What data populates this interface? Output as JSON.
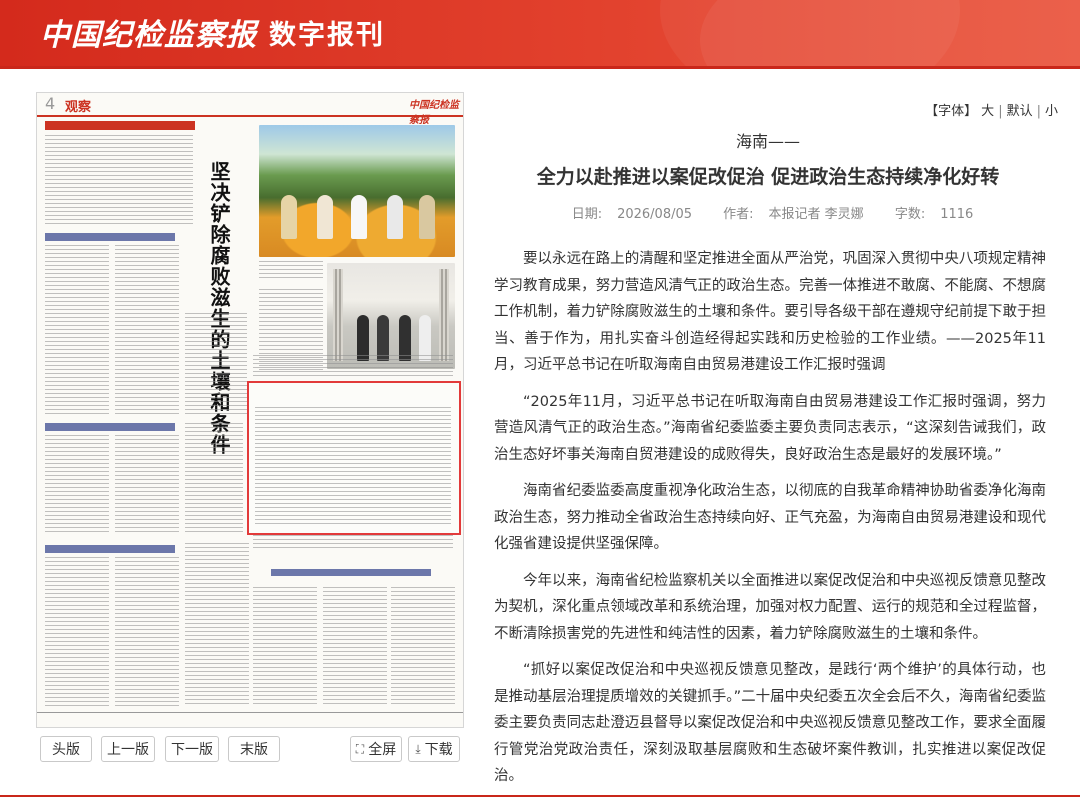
{
  "header": {
    "logo_text": "中国纪检监察报",
    "subtitle": "数字报刊"
  },
  "paper": {
    "page_number": "4",
    "section": "观察",
    "masthead": "中国纪检监察报",
    "vertical_title": "坚决铲除腐败滋生的土壤和条件",
    "highlight_color": "#e23a3a",
    "highlighted_article_title": "全力以赴推进以案促改促治 促进政治生态持续净化好转"
  },
  "nav": {
    "first_page": "头版",
    "prev_page": "上一版",
    "next_page": "下一版",
    "last_page": "末版",
    "fullscreen": "全屏",
    "download": "下载"
  },
  "font_control": {
    "label": "【字体】",
    "large": "大",
    "default": "默认",
    "small": "小"
  },
  "article": {
    "kicker": "海南——",
    "title": "全力以赴推进以案促改促治 促进政治生态持续净化好转",
    "date_label": "日期:",
    "date": "2026/08/05",
    "author_label": "作者:",
    "author": "本报记者 李灵娜",
    "wordcount_label": "字数:",
    "wordcount": "1116",
    "paragraphs": [
      "要以永远在路上的清醒和坚定推进全面从严治党，巩固深入贯彻中央八项规定精神学习教育成果，努力营造风清气正的政治生态。完善一体推进不敢腐、不能腐、不想腐工作机制，着力铲除腐败滋生的土壤和条件。要引导各级干部在遵规守纪前提下敢于担当、善于作为，用扎实奋斗创造经得起实践和历史检验的工作业绩。——2025年11月，习近平总书记在听取海南自由贸易港建设工作汇报时强调",
      "“2025年11月，习近平总书记在听取海南自由贸易港建设工作汇报时强调，努力营造风清气正的政治生态。”海南省纪委监委主要负责同志表示，“这深刻告诫我们，政治生态好坏事关海南自贸港建设的成败得失，良好政治生态是最好的发展环境。”",
      "海南省纪委监委高度重视净化政治生态，以彻底的自我革命精神协助省委净化海南政治生态，努力推动全省政治生态持续向好、正气充盈，为海南自由贸易港建设和现代化强省建设提供坚强保障。",
      "今年以来，海南省纪检监察机关以全面推进以案促改促治和中央巡视反馈意见整改为契机，深化重点领域改革和系统治理，加强对权力配置、运行的规范和全过程监督，不断清除损害党的先进性和纯洁性的因素，着力铲除腐败滋生的土壤和条件。",
      "“抓好以案促改促治和中央巡视反馈意见整改，是践行‘两个维护’的具体行动，也是推动基层治理提质增效的关键抓手。”二十届中央纪委五次全会后不久，海南省纪委监委主要负责同志赴澄迈县督导以案促改促治和中央巡视反馈意见整改工作，要求全面履行管党治党政治责任，深刻汲取基层腐败和生态破坏案件教训，扎实推进以案促改促治。"
    ]
  }
}
